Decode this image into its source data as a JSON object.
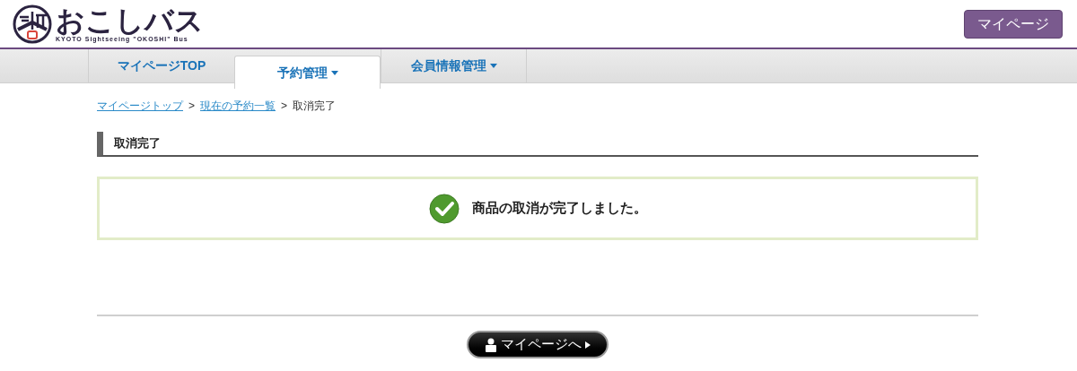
{
  "logo": {
    "title": "おこしバス",
    "subtitle": "KYOTO Sightseeing \"OKOSHI\" Bus"
  },
  "header_button": "マイページ",
  "tabs": [
    {
      "label": "マイページTOP",
      "selected": false,
      "dropdown": false
    },
    {
      "label": "予約管理",
      "selected": true,
      "dropdown": true
    },
    {
      "label": "会員情報管理",
      "selected": false,
      "dropdown": true
    }
  ],
  "breadcrumb": [
    {
      "label": "マイページトップ",
      "kind": "link"
    },
    {
      "label": "現在の予約一覧",
      "kind": "link"
    },
    {
      "label": "取消完了",
      "kind": "current"
    }
  ],
  "separator": ">",
  "heading": "取消完了",
  "message": "商品の取消が完了しました。",
  "bottom_button": "マイページへ"
}
